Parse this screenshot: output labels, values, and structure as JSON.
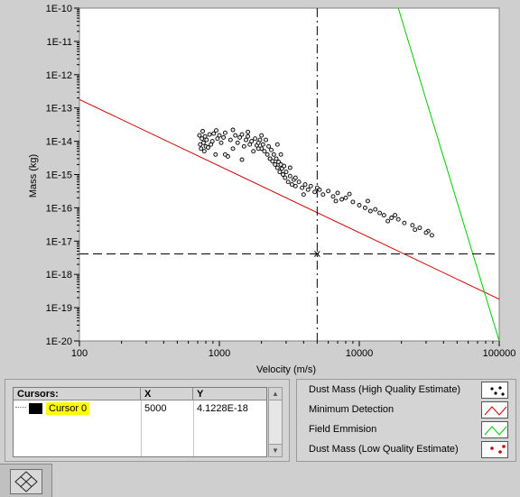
{
  "chart_data": {
    "type": "scatter",
    "title": "",
    "xlabel": "Velocity (m/s)",
    "ylabel": "Mass (kg)",
    "x_scale": "log",
    "y_scale": "log",
    "xlim": [
      100,
      100000
    ],
    "ylim": [
      1e-20,
      1e-10
    ],
    "grid": false,
    "x_ticks": [
      100,
      1000,
      10000,
      100000
    ],
    "x_tick_labels": [
      "100",
      "1000",
      "10000",
      "100000"
    ],
    "y_ticks": [
      1e-10,
      1e-11,
      1e-12,
      1e-13,
      1e-14,
      1e-15,
      1e-16,
      1e-17,
      1e-18,
      1e-19,
      1e-20
    ],
    "y_tick_labels": [
      "1E-10",
      "1E-11",
      "1E-12",
      "1E-13",
      "1E-14",
      "1E-15",
      "1E-16",
      "1E-17",
      "1E-18",
      "1E-19",
      "1E-20"
    ],
    "series": [
      {
        "name": "Dust Mass (High Quality Estimate)",
        "type": "scatter",
        "color": "#000000",
        "points": [
          [
            720,
            1.5e-14
          ],
          [
            730,
            8e-15
          ],
          [
            740,
            6e-15
          ],
          [
            750,
            1.2e-14
          ],
          [
            760,
            2e-14
          ],
          [
            770,
            9e-15
          ],
          [
            780,
            5e-15
          ],
          [
            790,
            1.4e-14
          ],
          [
            800,
            7e-15
          ],
          [
            810,
            1.1e-14
          ],
          [
            830,
            6.5e-15
          ],
          [
            850,
            1.6e-14
          ],
          [
            870,
            8e-15
          ],
          [
            890,
            1e-14
          ],
          [
            910,
            1.7e-14
          ],
          [
            940,
            4e-15
          ],
          [
            970,
            1.2e-14
          ],
          [
            1000,
            1.5e-14
          ],
          [
            1030,
            9e-15
          ],
          [
            1070,
            1.3e-14
          ],
          [
            1100,
            1.8e-14
          ],
          [
            1150,
            3.5e-15
          ],
          [
            1200,
            1.1e-14
          ],
          [
            1250,
            6e-15
          ],
          [
            1300,
            1.5e-14
          ],
          [
            1350,
            9e-15
          ],
          [
            1400,
            1.3e-14
          ],
          [
            1450,
            1.6e-14
          ],
          [
            1500,
            7e-15
          ],
          [
            1550,
            1.1e-14
          ],
          [
            1600,
            1.4e-14
          ],
          [
            1650,
            8e-15
          ],
          [
            1700,
            1e-14
          ],
          [
            1750,
            5e-15
          ],
          [
            1800,
            1.2e-14
          ],
          [
            1850,
            7.5e-15
          ],
          [
            1900,
            9e-15
          ],
          [
            1950,
            1.1e-14
          ],
          [
            2000,
            6e-15
          ],
          [
            2050,
            8e-15
          ],
          [
            2100,
            5e-15
          ],
          [
            2150,
            1.1e-14
          ],
          [
            2200,
            4e-15
          ],
          [
            2250,
            7e-15
          ],
          [
            2300,
            3e-15
          ],
          [
            2350,
            5.5e-15
          ],
          [
            2400,
            2.5e-15
          ],
          [
            2450,
            4e-15
          ],
          [
            2500,
            2e-15
          ],
          [
            2550,
            3e-15
          ],
          [
            2600,
            1.6e-15
          ],
          [
            2650,
            2.4e-15
          ],
          [
            2700,
            1.2e-15
          ],
          [
            2750,
            2e-15
          ],
          [
            2800,
            1.5e-15
          ],
          [
            2850,
            1e-15
          ],
          [
            2900,
            1.8e-15
          ],
          [
            2950,
            8e-16
          ],
          [
            3000,
            1.2e-15
          ],
          [
            3100,
            6e-16
          ],
          [
            3200,
            9e-16
          ],
          [
            3300,
            5e-16
          ],
          [
            3400,
            7e-16
          ],
          [
            3500,
            4.5e-16
          ],
          [
            3700,
            6e-16
          ],
          [
            3900,
            4e-16
          ],
          [
            4100,
            5e-16
          ],
          [
            4300,
            3.5e-16
          ],
          [
            4500,
            4.5e-16
          ],
          [
            4800,
            3e-16
          ],
          [
            5200,
            3.5e-16
          ],
          [
            5500,
            2.5e-16
          ],
          [
            6000,
            3.2e-16
          ],
          [
            6500,
            2.2e-16
          ],
          [
            7000,
            2.8e-16
          ],
          [
            7500,
            1.8e-16
          ],
          [
            8000,
            2e-16
          ],
          [
            9000,
            1.5e-16
          ],
          [
            10000,
            1.2e-16
          ],
          [
            11000,
            1e-16
          ],
          [
            12000,
            8e-17
          ],
          [
            13000,
            9e-17
          ],
          [
            14000,
            7e-17
          ],
          [
            15000,
            6e-17
          ],
          [
            17000,
            5e-17
          ],
          [
            19000,
            4.5e-17
          ],
          [
            21000,
            3.5e-17
          ],
          [
            24000,
            3e-17
          ],
          [
            27000,
            2.5e-17
          ],
          [
            31000,
            2e-17
          ],
          [
            33000,
            1.5e-17
          ],
          [
            2300,
            3e-15
          ],
          [
            1900,
            6e-15
          ],
          [
            1600,
            1.9e-14
          ],
          [
            1250,
            2.2e-14
          ],
          [
            2600,
            8e-15
          ],
          [
            1100,
            4e-15
          ],
          [
            2750,
            4e-15
          ],
          [
            3200,
            1.6e-15
          ],
          [
            1450,
            2.8e-15
          ],
          [
            2000,
            1.5e-14
          ],
          [
            950,
            2.1e-14
          ],
          [
            3500,
            8e-16
          ],
          [
            4000,
            2.5e-16
          ],
          [
            5000,
            4e-16
          ],
          [
            6800,
            1.6e-16
          ],
          [
            8500,
            2.6e-16
          ],
          [
            11500,
            1.6e-16
          ],
          [
            16000,
            4e-17
          ],
          [
            18000,
            6e-17
          ],
          [
            25000,
            2.2e-17
          ],
          [
            30000,
            1.8e-17
          ]
        ]
      },
      {
        "name": "Minimum Detection",
        "type": "line",
        "color": "#cc0000",
        "points": [
          [
            100,
            1.8e-13
          ],
          [
            100000,
            1.8e-19
          ]
        ]
      },
      {
        "name": "Field Emmision",
        "type": "line",
        "color": "#00cc00",
        "points": [
          [
            19000,
            1e-10
          ],
          [
            100000,
            1e-20
          ]
        ]
      },
      {
        "name": "Dust Mass (Low Quality Estimate)",
        "type": "scatter",
        "color": "#cc0000",
        "points": []
      }
    ],
    "cursor": {
      "x": 5000,
      "y": 4.1228e-18
    }
  },
  "cursor_table": {
    "headers": {
      "name": "Cursors:",
      "x": "X",
      "y": "Y"
    },
    "rows": [
      {
        "name": "Cursor 0",
        "x": "5000",
        "y": "4.1228E-18",
        "swatch_color": "#000000",
        "name_highlight": "#ffff00"
      }
    ]
  },
  "legend": [
    {
      "label": "Dust Mass (High Quality Estimate)",
      "swatch": "scatter-dots",
      "color": "#000000"
    },
    {
      "label": "Minimum Detection",
      "swatch": "line",
      "color": "#cc0000"
    },
    {
      "label": "Field Emmision",
      "swatch": "line",
      "color": "#00cc00"
    },
    {
      "label": "Dust Mass (Low Quality Estimate)",
      "swatch": "scatter-dots",
      "color": "#cc0000"
    }
  ],
  "controls": {
    "nav_icon": "move-diamond-icon",
    "scroll_up_icon": "scroll-up-icon",
    "scroll_down_icon": "scroll-down-icon"
  }
}
